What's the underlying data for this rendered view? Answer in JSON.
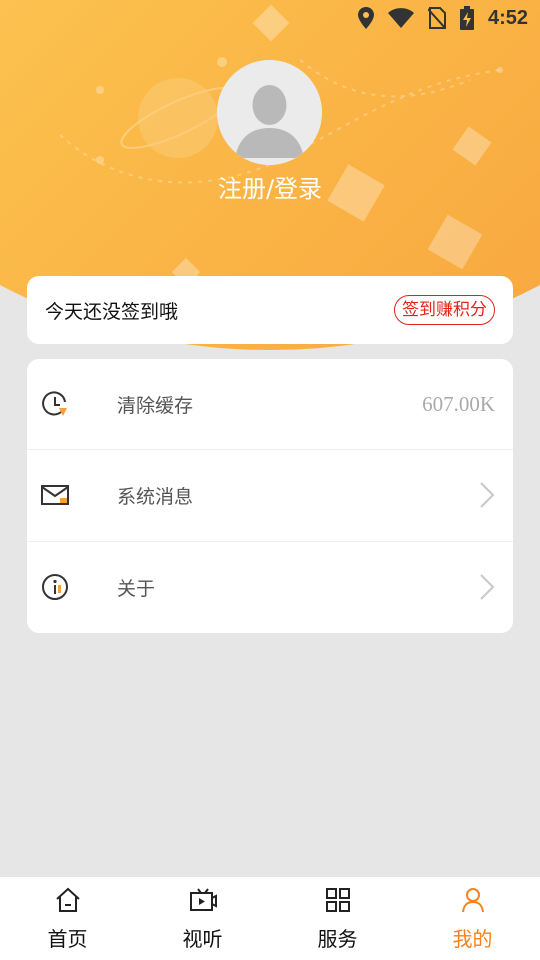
{
  "status_bar": {
    "time": "4:52"
  },
  "profile": {
    "login_label": "注册/登录"
  },
  "sign_in": {
    "text": "今天还没签到哦",
    "button_label": "签到赚积分"
  },
  "menu": {
    "items": [
      {
        "label": "清除缓存",
        "value": "607.00K",
        "icon": "clock-icon"
      },
      {
        "label": "系统消息",
        "icon": "mail-icon"
      },
      {
        "label": "关于",
        "icon": "info-icon"
      }
    ]
  },
  "bottom_nav": {
    "items": [
      {
        "label": "首页",
        "icon": "home-icon"
      },
      {
        "label": "视听",
        "icon": "tv-icon"
      },
      {
        "label": "服务",
        "icon": "grid-icon"
      },
      {
        "label": "我的",
        "icon": "user-icon",
        "active": true
      }
    ]
  },
  "colors": {
    "accent": "#f58220",
    "header_gradient_start": "#fdd568",
    "header_gradient_end": "#f8a13c",
    "sign_button": "#e0241a",
    "background": "#e6e6e6"
  }
}
